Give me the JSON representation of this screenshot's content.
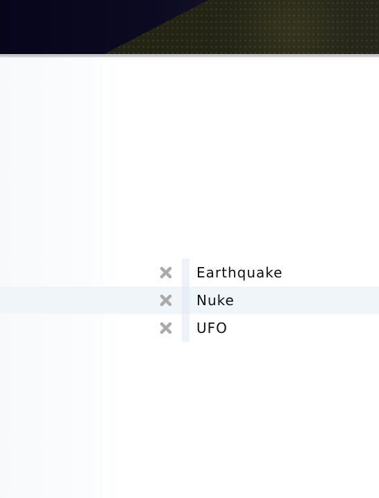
{
  "colors": {
    "row_highlight": "#f0f5f9",
    "remove_icon": "#aaaaaa",
    "text": "#111111"
  },
  "items": [
    {
      "label": "Earthquake",
      "remove_icon": "close-icon",
      "highlighted": false
    },
    {
      "label": "Nuke",
      "remove_icon": "close-icon",
      "highlighted": true
    },
    {
      "label": "UFO",
      "remove_icon": "close-icon",
      "highlighted": false
    }
  ]
}
